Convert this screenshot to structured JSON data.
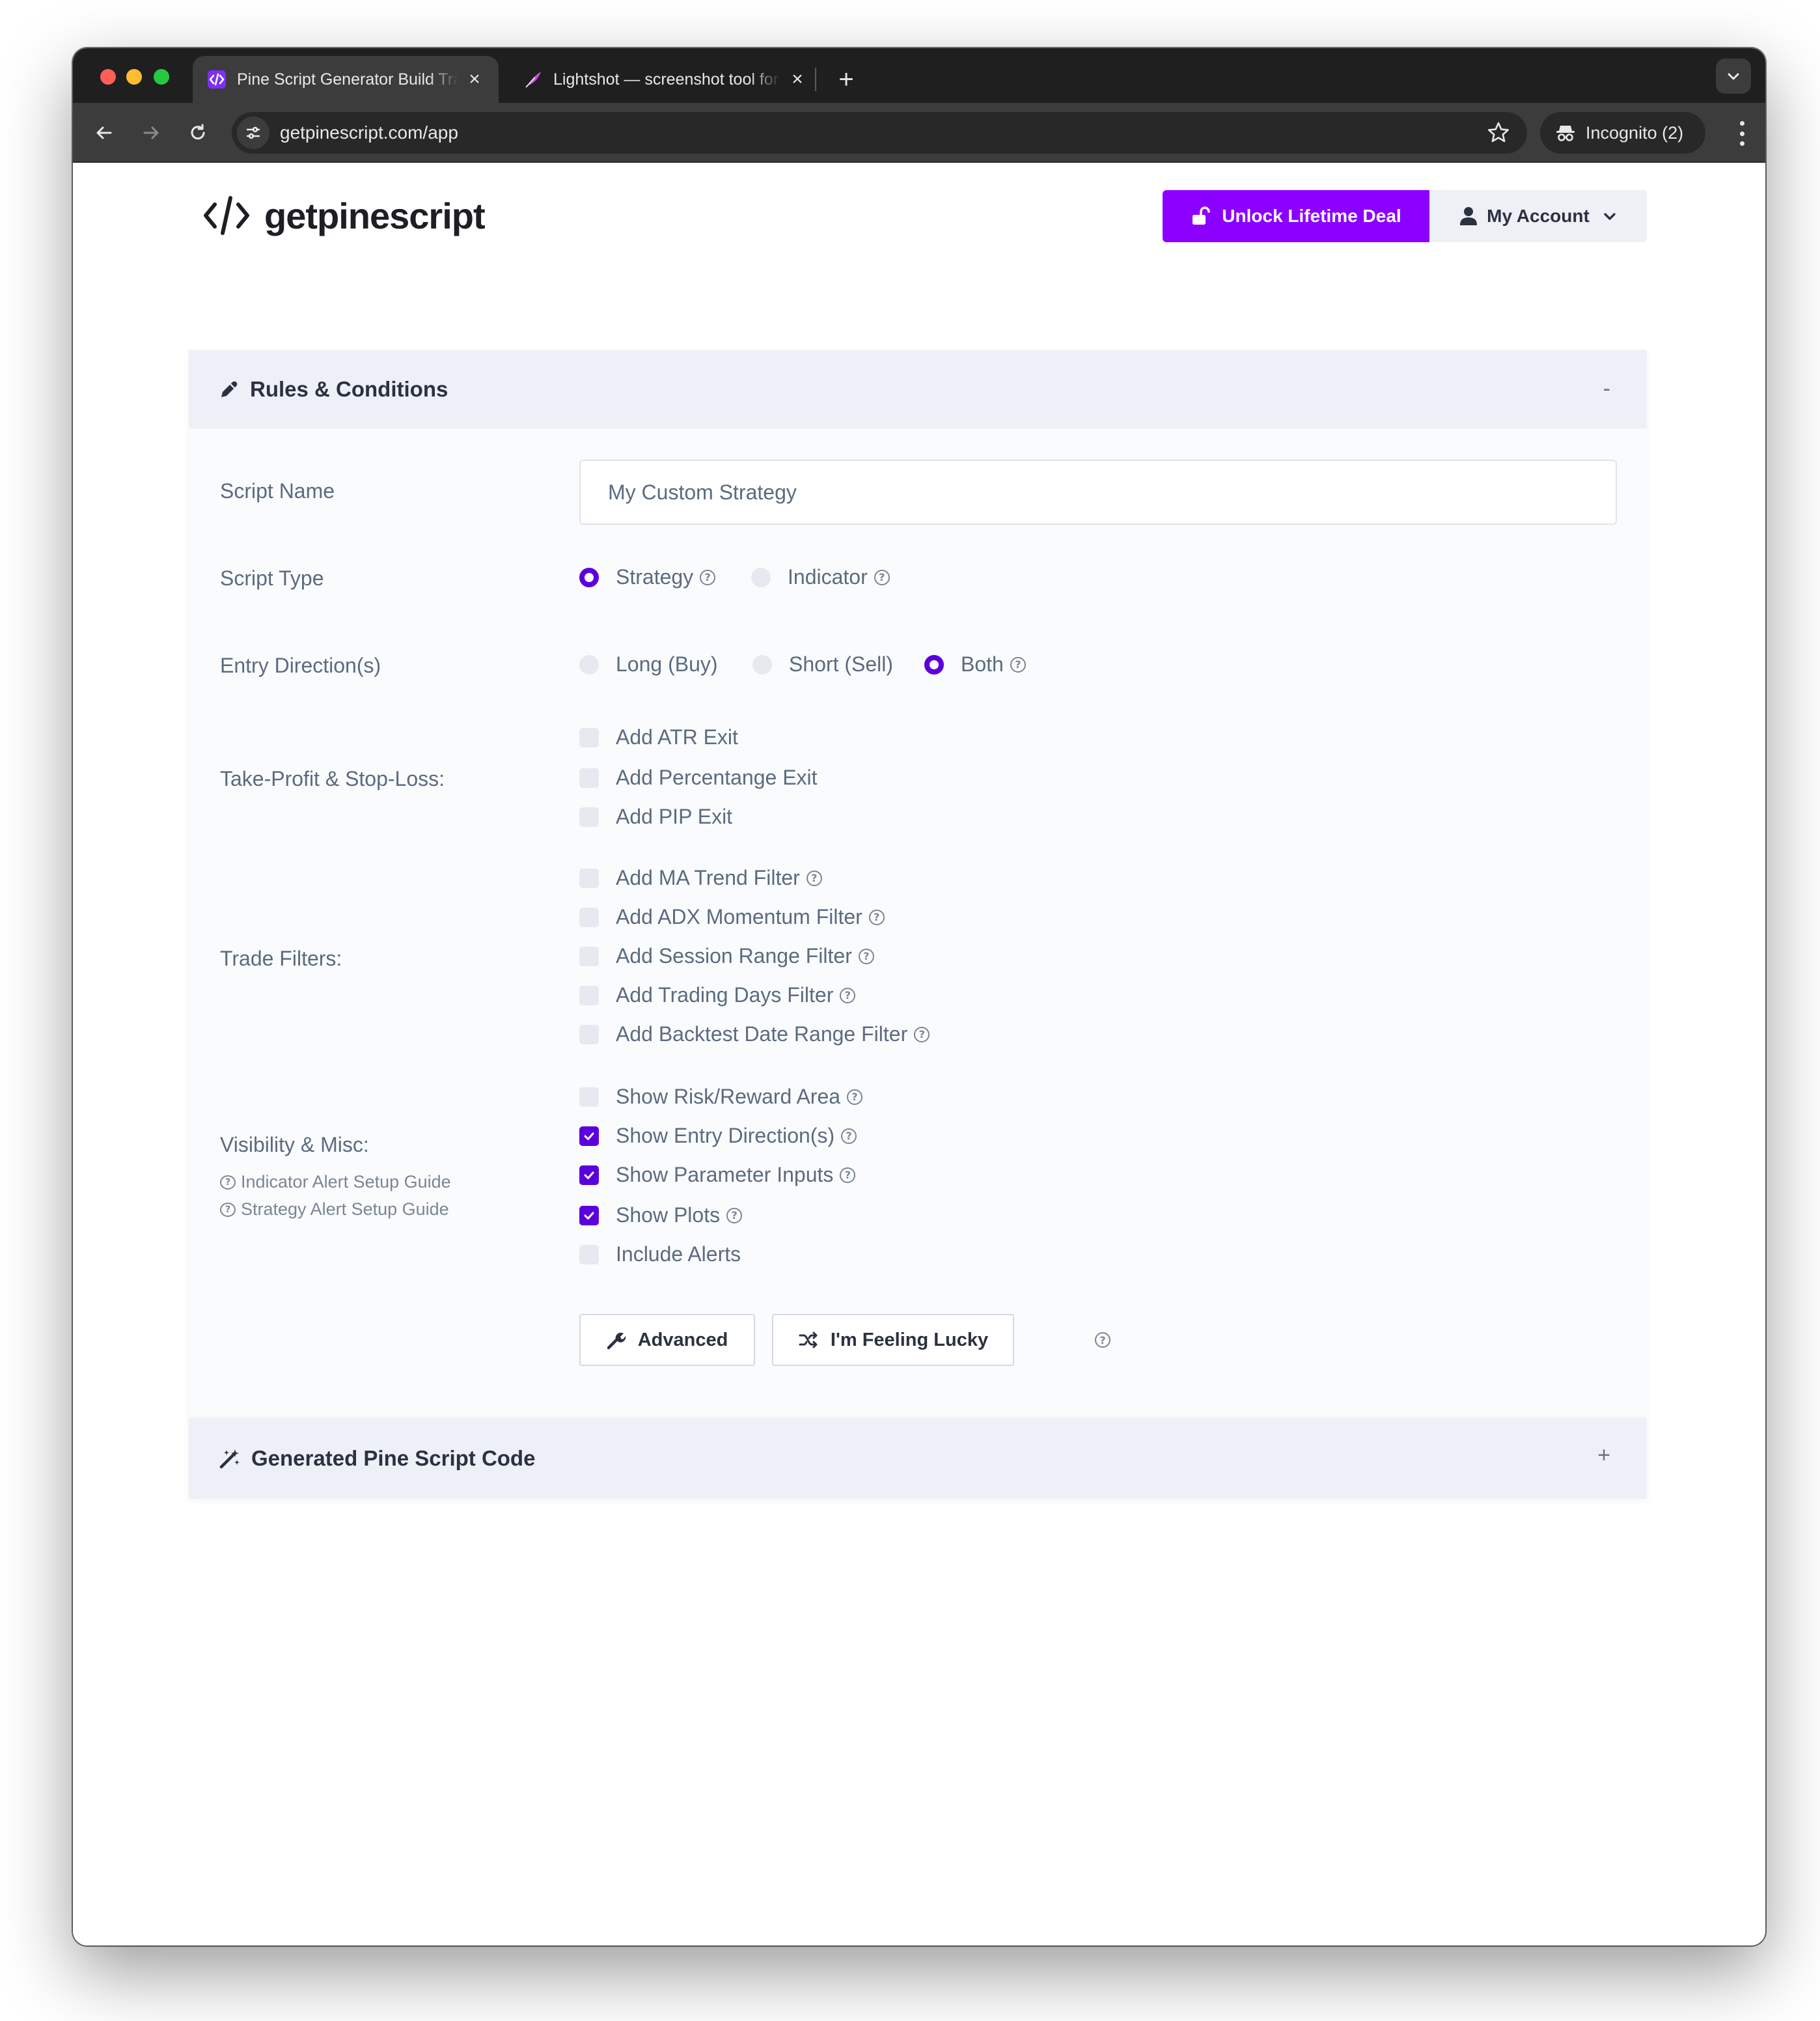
{
  "browser": {
    "tabs": [
      {
        "title": "Pine Script Generator Build Trading",
        "active": true
      },
      {
        "title": "Lightshot — screenshot tool for Mac",
        "active": false
      }
    ],
    "close_glyph": "×",
    "new_tab_glyph": "+",
    "url": "getpinescript.com/app",
    "incognito_label": "Incognito (2)"
  },
  "header": {
    "logo_mark": "</>",
    "logo_text": "getpinescript",
    "deal_button": "Unlock Lifetime Deal",
    "account_button": "My Account"
  },
  "rules_panel": {
    "title": "Rules & Conditions",
    "toggle": "-",
    "script_name": {
      "label": "Script Name",
      "value": "My Custom Strategy"
    },
    "script_type": {
      "label": "Script Type",
      "options": [
        {
          "label": "Strategy",
          "selected": true
        },
        {
          "label": "Indicator",
          "selected": false
        }
      ]
    },
    "entry_direction": {
      "label": "Entry Direction(s)",
      "options": [
        {
          "label": "Long (Buy)",
          "selected": false
        },
        {
          "label": "Short (Sell)",
          "selected": false
        },
        {
          "label": "Both",
          "selected": true
        }
      ]
    },
    "tp_sl": {
      "label": "Take-Profit & Stop-Loss:",
      "options": [
        {
          "label": "Add ATR Exit",
          "checked": false
        },
        {
          "label": "Add Percentange Exit",
          "checked": false
        },
        {
          "label": "Add PIP Exit",
          "checked": false
        }
      ]
    },
    "trade_filters": {
      "label": "Trade Filters:",
      "options": [
        {
          "label": "Add MA Trend Filter",
          "checked": false
        },
        {
          "label": "Add ADX Momentum Filter",
          "checked": false
        },
        {
          "label": "Add Session Range Filter",
          "checked": false
        },
        {
          "label": "Add Trading Days Filter",
          "checked": false
        },
        {
          "label": "Add Backtest Date Range Filter",
          "checked": false
        }
      ]
    },
    "visibility": {
      "label": "Visibility & Misc:",
      "links": [
        "Indicator Alert Setup Guide",
        "Strategy Alert Setup Guide"
      ],
      "options": [
        {
          "label": "Show Risk/Reward Area",
          "checked": false
        },
        {
          "label": "Show Entry Direction(s)",
          "checked": true
        },
        {
          "label": "Show Parameter Inputs",
          "checked": true
        },
        {
          "label": "Show Plots",
          "checked": true
        },
        {
          "label": "Include Alerts",
          "checked": false
        }
      ]
    },
    "buttons": {
      "advanced": "Advanced",
      "lucky": "I'm Feeling Lucky"
    }
  },
  "code_panel": {
    "title": "Generated Pine Script Code",
    "toggle": "+"
  },
  "colors": {
    "accent": "#5b00dd",
    "deal_purple": "#8b00ff",
    "panel_header": "#eef0f7",
    "label_text": "#5b6b80"
  },
  "icons": [
    "code-brackets-icon",
    "feather-icon",
    "back-arrow-icon",
    "forward-arrow-icon",
    "reload-icon",
    "site-settings-icon",
    "star-icon",
    "incognito-icon",
    "kebab-menu-icon",
    "unlock-icon",
    "user-icon",
    "chevron-down-icon",
    "pencil-icon",
    "magic-wand-icon",
    "wrench-icon",
    "shuffle-icon",
    "help-circle-icon",
    "check-icon"
  ]
}
